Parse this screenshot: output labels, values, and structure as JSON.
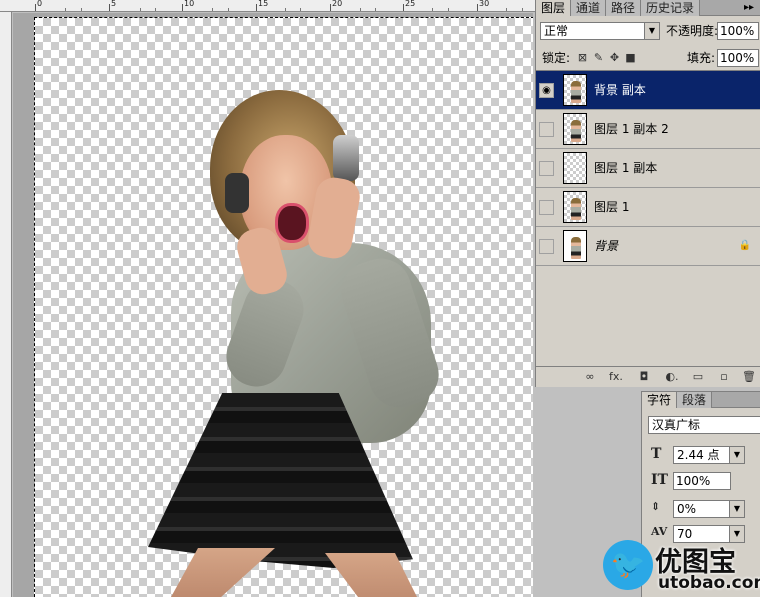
{
  "ruler": {
    "labels": [
      "0",
      "5",
      "10",
      "15",
      "20",
      "25",
      "30"
    ]
  },
  "layers_panel": {
    "tabs": [
      {
        "label": "图层",
        "active": true
      },
      {
        "label": "通道",
        "active": false
      },
      {
        "label": "路径",
        "active": false
      },
      {
        "label": "历史记录",
        "active": false
      }
    ],
    "more_glyph": "▸▸",
    "blend_mode": "正常",
    "opacity_label": "不透明度:",
    "opacity_value": "100%",
    "lock_label": "锁定:",
    "fill_label": "填充:",
    "fill_value": "100%",
    "layers": [
      {
        "name": "背景 副本",
        "selected": true,
        "visible": true,
        "thumb": "figure"
      },
      {
        "name": "图层 1 副本 2",
        "selected": false,
        "visible": false,
        "thumb": "figure"
      },
      {
        "name": "图层 1 副本",
        "selected": false,
        "visible": false,
        "thumb": "empty"
      },
      {
        "name": "图层 1",
        "selected": false,
        "visible": false,
        "thumb": "figure"
      },
      {
        "name": "背景",
        "selected": false,
        "visible": false,
        "thumb": "figure-white",
        "italic": true,
        "locked": true
      }
    ],
    "footer_icons": [
      "link-icon",
      "fx-icon",
      "mask-icon",
      "adjustment-icon",
      "folder-icon",
      "new-layer-icon",
      "trash-icon"
    ],
    "footer_glyphs": [
      "∞",
      "fx.",
      "◘",
      "◐.",
      "▭",
      "▫",
      "🗑"
    ]
  },
  "character_panel": {
    "tabs": [
      {
        "label": "字符",
        "active": true
      },
      {
        "label": "段落",
        "active": false
      }
    ],
    "font_family": "汉真广标",
    "font_size": "2.44 点",
    "vertical_scale": "100%",
    "tracking_ratio": "0%",
    "tracking": "70"
  },
  "watermark": {
    "brand": "优图宝",
    "url": "utobao.com"
  }
}
